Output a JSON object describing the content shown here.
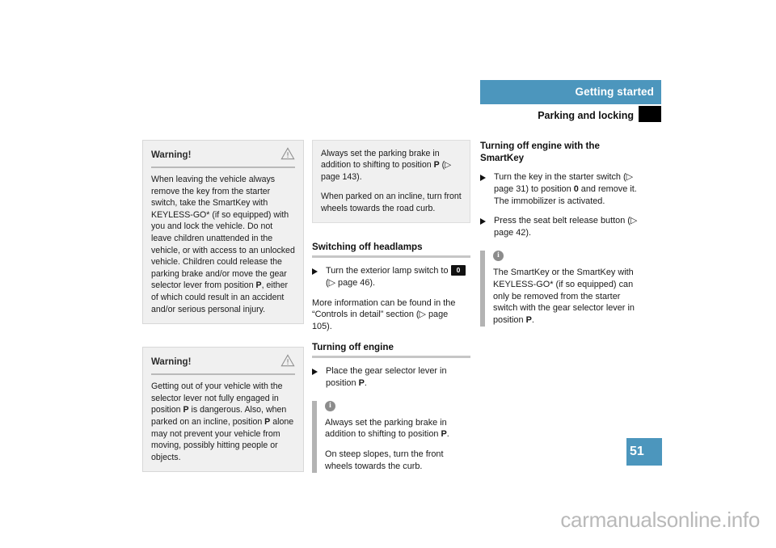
{
  "header": {
    "chapter_title": "Getting started",
    "section_title": "Parking and locking",
    "accent_color": "#4c96bd",
    "tab_marker_color": "#000000"
  },
  "left_column": {
    "warnings": [
      {
        "label": "Warning!",
        "icon": "warning-triangle-icon",
        "text": "When leaving the vehicle always remove the key from the starter switch, take the SmartKey with KEYLESS-GO* (if so equipped) with you and lock the vehicle. Do not leave children unattended in the vehicle, or with access to an unlocked vehicle. Children could release the parking brake and/or move the gear selector lever from position P, either of which could result in an accident and/or serious personal injury."
      },
      {
        "label": "Warning!",
        "icon": "warning-triangle-icon",
        "text": "Getting out of your vehicle with the selector lever not fully engaged in position P is dangerous. Also, when parked on an incline, position P alone may not prevent your vehicle from moving, possibly hitting people or objects."
      }
    ]
  },
  "middle_column": {
    "info_panel": {
      "paragraph_1": "Always set the parking brake in addition to shifting to position P (▷ page 143).",
      "paragraph_2": "When parked on an incline, turn front wheels towards the road curb."
    },
    "section_headlamps": {
      "heading": "Switching off headlamps",
      "bullet_1_prefix": "Turn the exterior lamp switch to",
      "bullet_1_badge": "0",
      "bullet_1_ref": "(▷ page 46).",
      "paragraph": "More information can be found in the “Controls in detail” section (▷ page 105)."
    },
    "section_engine": {
      "heading": "Turning off engine",
      "bullet_1": "Place the gear selector lever in position P.",
      "note": {
        "icon": "info-circle-icon",
        "paragraph_1": "Always set the parking brake in addition to shifting to position P.",
        "paragraph_2": "On steep slopes, turn the front wheels towards the curb."
      }
    }
  },
  "right_column": {
    "section_smartkey": {
      "heading": "Turning off engine with the SmartKey",
      "bullet_1": "Turn the key in the starter switch (▷ page 31) to position 0 and remove it.",
      "bullet_1_extra": "The immobilizer is activated.",
      "bullet_2": "Press the seat belt release button (▷ page 42).",
      "note": {
        "icon": "info-circle-icon",
        "paragraph_1": "The SmartKey or the SmartKey with KEYLESS-GO* (if so equipped) can only be removed from the starter switch with the gear selector lever in position P."
      }
    }
  },
  "footer": {
    "page_number": "51",
    "watermark": "carmanualsonline.info"
  }
}
